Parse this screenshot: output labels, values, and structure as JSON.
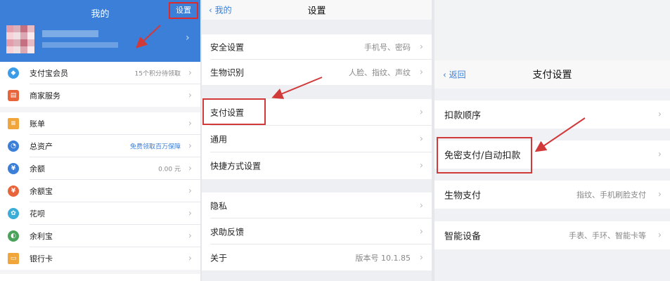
{
  "panel1": {
    "title": "我的",
    "settings_label": "设置",
    "rows": [
      {
        "label": "支付宝会员",
        "value": "15个积分待领取",
        "icon": "member-icon",
        "color": "#3b9de8"
      },
      {
        "label": "商家服务",
        "value": "",
        "icon": "merchant-icon",
        "color": "#e8643b"
      },
      {
        "label": "账单",
        "value": "",
        "icon": "bill-icon",
        "color": "#f0a63b"
      },
      {
        "label": "总资产",
        "value": "免费领取百万保障",
        "icon": "assets-icon",
        "color": "#3b7fd8"
      },
      {
        "label": "余额",
        "value": "0.00 元",
        "icon": "balance-icon",
        "color": "#3b7fd8"
      },
      {
        "label": "余额宝",
        "value": "",
        "icon": "yuebao-icon",
        "color": "#e8643b"
      },
      {
        "label": "花呗",
        "value": "",
        "icon": "huabei-icon",
        "color": "#3baed8"
      },
      {
        "label": "余利宝",
        "value": "",
        "icon": "yulibao-icon",
        "color": "#e8823b"
      },
      {
        "label": "银行卡",
        "value": "",
        "icon": "bank-card-icon",
        "color": "#f0a63b"
      }
    ]
  },
  "panel2": {
    "back_label": "我的",
    "title": "设置",
    "rows": [
      {
        "label": "安全设置",
        "value": "手机号、密码"
      },
      {
        "label": "生物识别",
        "value": "人脸、指纹、声纹"
      },
      {
        "label": "支付设置",
        "value": ""
      },
      {
        "label": "通用",
        "value": ""
      },
      {
        "label": "快捷方式设置",
        "value": ""
      },
      {
        "label": "隐私",
        "value": ""
      },
      {
        "label": "求助反馈",
        "value": ""
      },
      {
        "label": "关于",
        "value": "版本号 10.1.85"
      }
    ]
  },
  "panel3": {
    "back_label": "返回",
    "title": "支付设置",
    "rows": [
      {
        "label": "扣款顺序",
        "value": ""
      },
      {
        "label": "免密支付/自动扣款",
        "value": ""
      },
      {
        "label": "生物支付",
        "value": "指纹、手机刷脸支付"
      },
      {
        "label": "智能设备",
        "value": "手表、手环、智能卡等"
      }
    ]
  },
  "colors": {
    "brand_blue": "#3b7fd8",
    "highlight_red": "#d23a3a"
  },
  "chevron": "›"
}
